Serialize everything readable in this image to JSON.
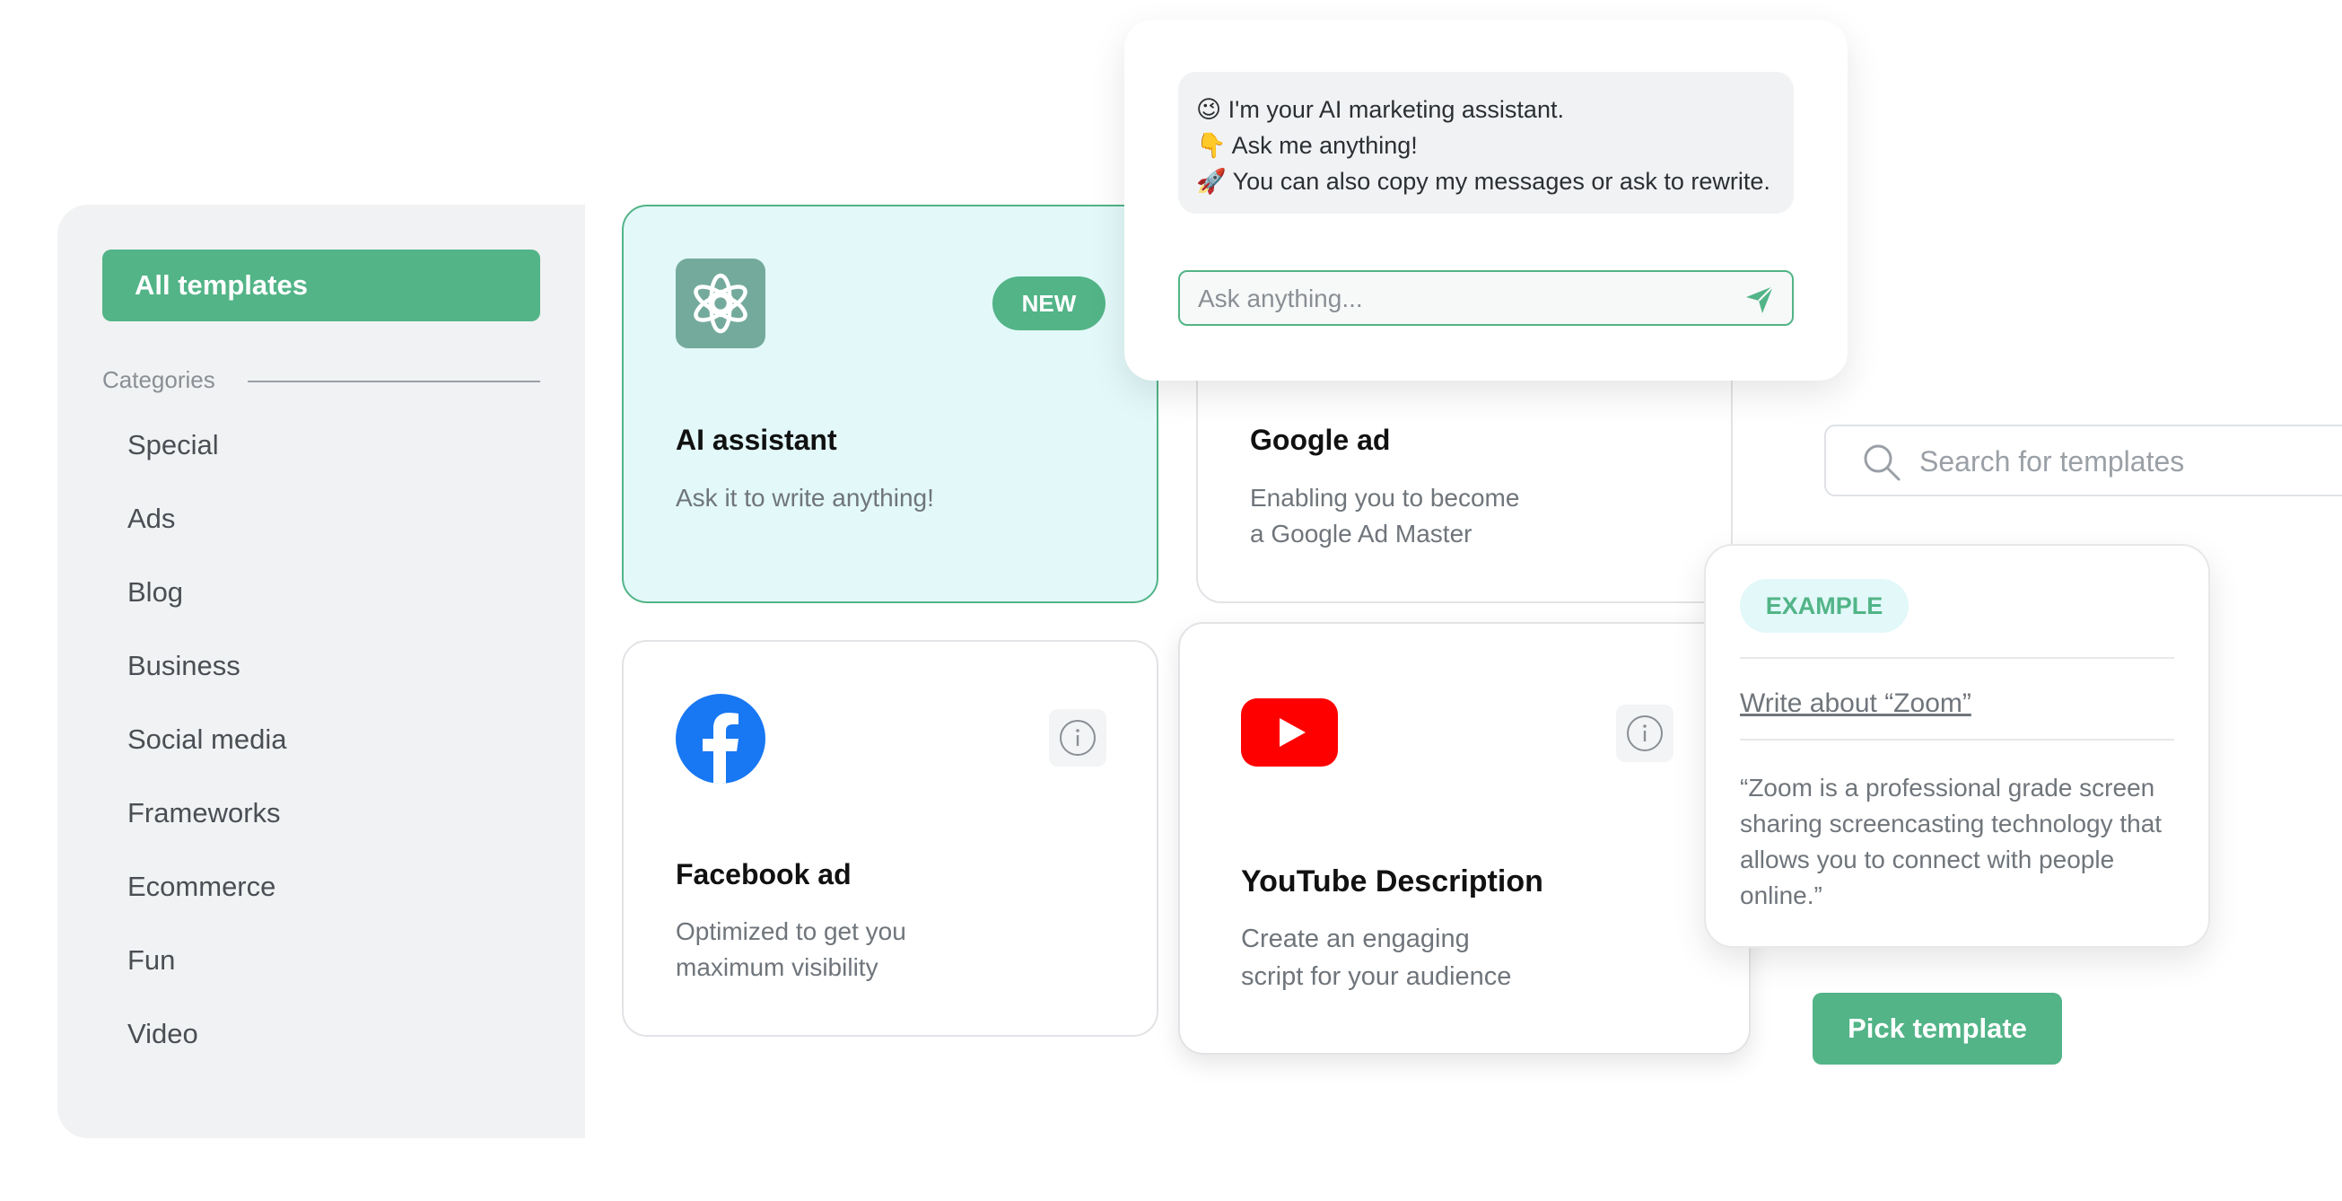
{
  "sidebar": {
    "all_templates_label": "All templates",
    "categories_label": "Categories",
    "items": [
      {
        "label": "Special"
      },
      {
        "label": "Ads"
      },
      {
        "label": "Blog"
      },
      {
        "label": "Business"
      },
      {
        "label": "Social media"
      },
      {
        "label": "Frameworks"
      },
      {
        "label": "Ecommerce"
      },
      {
        "label": "Fun"
      },
      {
        "label": "Video"
      }
    ]
  },
  "cards": {
    "ai": {
      "title": "AI assistant",
      "desc": "Ask it to write anything!",
      "badge": "NEW",
      "icon": "chatgpt-icon"
    },
    "google": {
      "title": "Google ad",
      "desc_lines": [
        "Enabling you to become",
        "a Google Ad Master"
      ]
    },
    "facebook": {
      "title": "Facebook ad",
      "desc_lines": [
        "Optimized to get you",
        "maximum visibility"
      ],
      "icon": "facebook-icon"
    },
    "youtube": {
      "title": "YouTube Description",
      "desc_lines": [
        "Create an engaging",
        "script for your audience"
      ],
      "icon": "youtube-icon"
    }
  },
  "chat": {
    "lines": [
      {
        "emoji": "😉",
        "text": "I'm your AI marketing assistant."
      },
      {
        "emoji": "👇",
        "text": "Ask me anything!"
      },
      {
        "emoji": "🚀",
        "text": "You can also copy my messages or ask to rewrite."
      }
    ],
    "input_placeholder": "Ask anything..."
  },
  "search": {
    "placeholder": "Search for templates"
  },
  "example": {
    "badge": "EXAMPLE",
    "title": "Write about “Zoom”",
    "body_lines": [
      "“Zoom is a professional grade screen",
      "sharing screencasting technology that",
      "allows you to connect with people",
      "online.”"
    ]
  },
  "pick_button_label": "Pick template",
  "colors": {
    "accent": "#52b487",
    "accent_light": "#e2f8f9",
    "sidebar_bg": "#f1f2f3",
    "youtube_red": "#ff0000",
    "facebook_blue": "#1877f2"
  }
}
